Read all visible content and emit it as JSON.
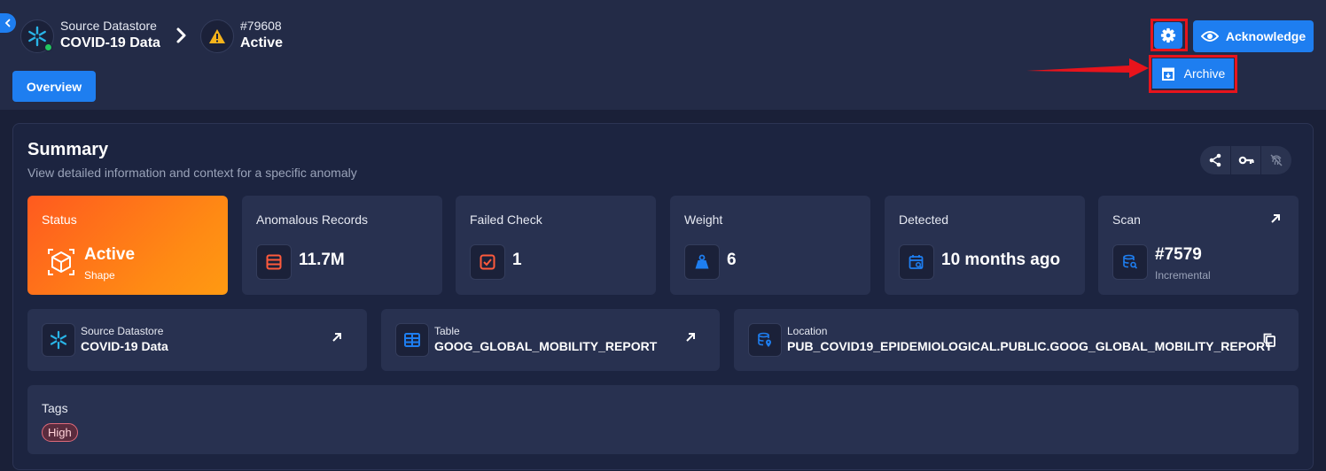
{
  "breadcrumb": {
    "datastore_label": "Source Datastore",
    "datastore_name": "COVID-19 Data",
    "anomaly_id": "#79608",
    "anomaly_status": "Active"
  },
  "tabs": {
    "overview": "Overview"
  },
  "toolbar": {
    "acknowledge_label": "Acknowledge",
    "archive_label": "Archive"
  },
  "summary": {
    "title": "Summary",
    "subtitle": "View detailed information and context for a specific anomaly"
  },
  "cards": {
    "status": {
      "label": "Status",
      "value": "Active",
      "sub": "Shape"
    },
    "records": {
      "label": "Anomalous Records",
      "value": "11.7M"
    },
    "failed": {
      "label": "Failed Check",
      "value": "1"
    },
    "weight": {
      "label": "Weight",
      "value": "6"
    },
    "detected": {
      "label": "Detected",
      "value": "10 months ago"
    },
    "scan": {
      "label": "Scan",
      "value": "#7579",
      "sub": "Incremental"
    }
  },
  "info": {
    "datastore": {
      "label": "Source Datastore",
      "value": "COVID-19 Data"
    },
    "table": {
      "label": "Table",
      "value": "GOOG_GLOBAL_MOBILITY_REPORT"
    },
    "location": {
      "label": "Location",
      "value": "PUB_COVID19_EPIDEMIOLOGICAL.PUBLIC.GOOG_GLOBAL_MOBILITY_REPORT"
    }
  },
  "tags": {
    "label": "Tags",
    "items": [
      "High"
    ]
  },
  "colors": {
    "accent": "#1e7ef0",
    "status_gradient_start": "#ff5a1f",
    "status_gradient_end": "#ff9a12",
    "highlight": "#e8141c",
    "tag_high": "#e06a7a"
  }
}
